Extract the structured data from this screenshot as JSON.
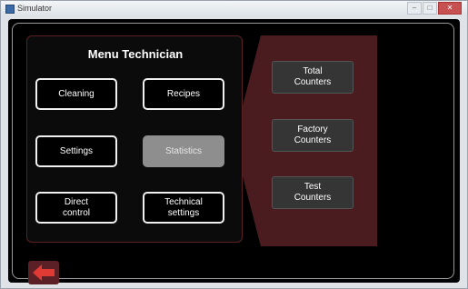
{
  "window": {
    "title": "Simulator",
    "controls": [
      "–",
      "□",
      "✕"
    ]
  },
  "menu": {
    "title": "Menu Technician",
    "buttons": [
      {
        "label": "Cleaning"
      },
      {
        "label": "Recipes"
      },
      {
        "label": "Settings"
      },
      {
        "label": "Statistics",
        "active": true
      },
      {
        "label": "Direct\ncontrol"
      },
      {
        "label": "Technical\nsettings"
      }
    ]
  },
  "counters": {
    "buttons": [
      {
        "label": "Total\nCounters"
      },
      {
        "label": "Factory\nCounters"
      },
      {
        "label": "Test\nCounters"
      }
    ]
  },
  "footer": {
    "back_icon": "arrow-left-icon"
  },
  "colors": {
    "panel_accent": "#4a1c1f",
    "active_button": "#8e8e8e",
    "back_arrow": "#e03a35"
  }
}
